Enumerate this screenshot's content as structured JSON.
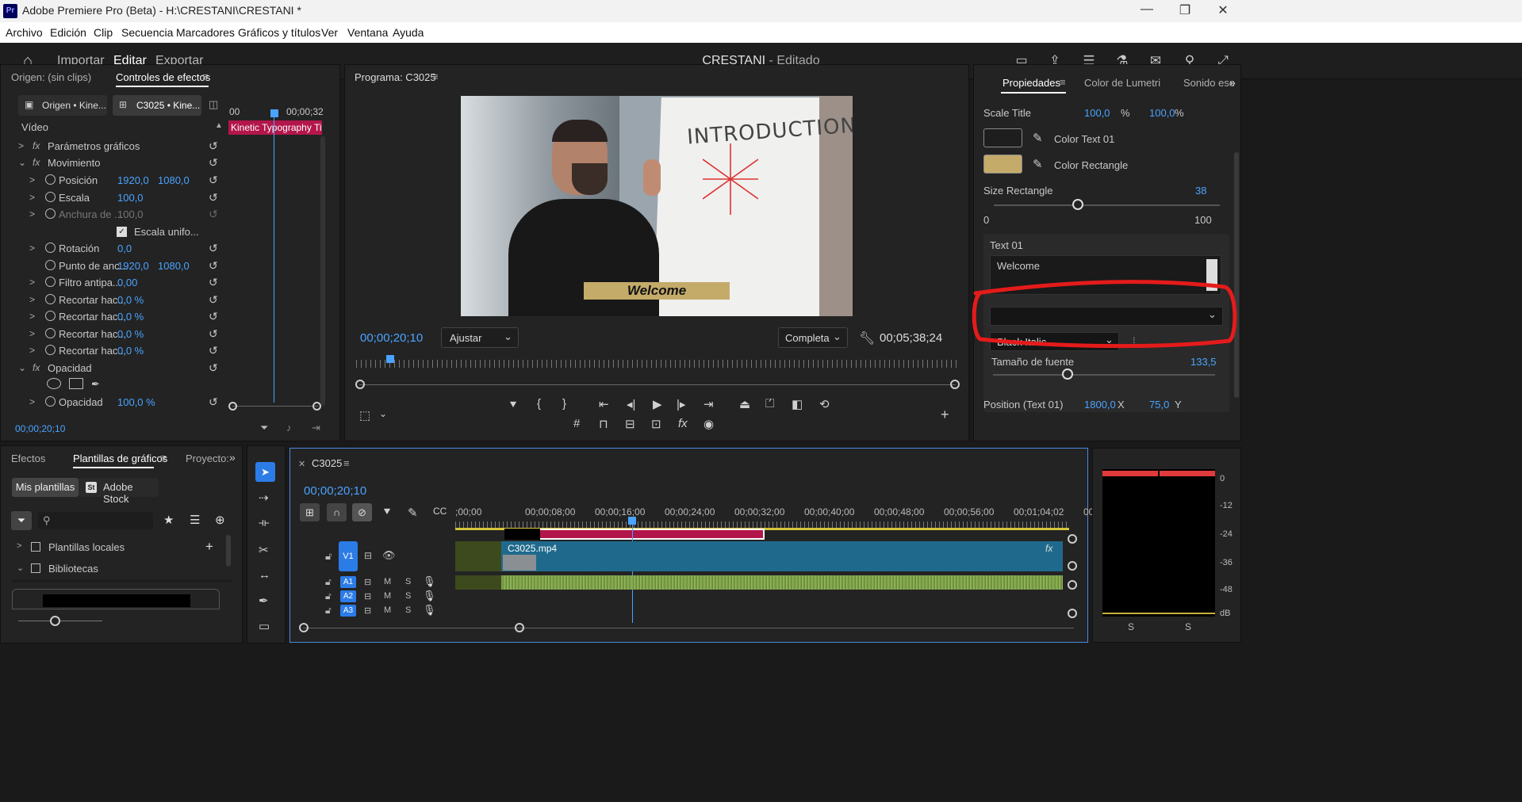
{
  "window": {
    "title": "Adobe Premiere Pro (Beta) - H:\\CRESTANI\\CRESTANI *",
    "app_badge": "Pr",
    "controls": [
      "—",
      "❐",
      "✕"
    ]
  },
  "menu": [
    "Archivo",
    "Edición",
    "Clip",
    "Secuencia",
    "Marcadores",
    "Gráficos y títulos",
    "Ver",
    "Ventana",
    "Ayuda"
  ],
  "header": {
    "nav": [
      "Importar",
      "Editar",
      "Exportar"
    ],
    "project_name": "CRESTANI",
    "project_status": " - Editado"
  },
  "effect_controls": {
    "tabs": [
      "Origen: (sin clips)",
      "Controles de efectos"
    ],
    "source_btn": "Origen • Kine...",
    "seq_btn": "C3025 • Kine...",
    "mini_time_start": "00",
    "mini_time_end": "00;00;32",
    "clip_label": "Kinetic Typography Tit",
    "section": "Vídeo",
    "rows": [
      {
        "label": "Parámetros gráficos",
        "v1": "",
        "v2": ""
      },
      {
        "label": "Movimiento",
        "v1": "",
        "v2": ""
      },
      {
        "label": "Posición",
        "v1": "1920,0",
        "v2": "1080,0"
      },
      {
        "label": "Escala",
        "v1": "100,0",
        "v2": ""
      },
      {
        "label": "Anchura de ...",
        "v1": "100,0",
        "v2": ""
      },
      {
        "label": "Escala unifo...",
        "v1": "",
        "v2": ""
      },
      {
        "label": "Rotación",
        "v1": "0,0",
        "v2": ""
      },
      {
        "label": "Punto de anc...",
        "v1": "1920,0",
        "v2": "1080,0"
      },
      {
        "label": "Filtro antipa...",
        "v1": "0,00",
        "v2": ""
      },
      {
        "label": "Recortar hac...",
        "v1": "0,0 %",
        "v2": ""
      },
      {
        "label": "Recortar hac...",
        "v1": "0,0 %",
        "v2": ""
      },
      {
        "label": "Recortar hac...",
        "v1": "0,0 %",
        "v2": ""
      },
      {
        "label": "Recortar hac...",
        "v1": "0,0 %",
        "v2": ""
      },
      {
        "label": "Opacidad",
        "v1": "",
        "v2": ""
      },
      {
        "label": "",
        "v1": "",
        "v2": ""
      },
      {
        "label": "Opacidad",
        "v1": "100,0 %",
        "v2": ""
      }
    ],
    "timecode": "00;00;20;10"
  },
  "program": {
    "title": "Programa: C3025",
    "timecode": "00;00;20;10",
    "fit": "Ajustar",
    "quality": "Completa",
    "duration": "00;05;38;24",
    "lower_third": "Welcome",
    "board_text": "INTRODUCTION"
  },
  "properties": {
    "tabs": [
      "Propiedades",
      "Color de Lumetri",
      "Sonido ese"
    ],
    "scale_title_label": "Scale Title",
    "scale_x": "100,0",
    "scale_y": "100,0",
    "pct": "%",
    "color_text_label": "Color Text 01",
    "color_rect_label": "Color Rectangle",
    "color_text_hex": "#1e1e1e",
    "color_rect_hex": "#c4ab6a",
    "size_rect_label": "Size Rectangle",
    "size_rect_value": "38",
    "size_min": "0",
    "size_max": "100",
    "text_label": "Text 01",
    "text_value": "Welcome",
    "font_dropdown": "",
    "font_style": "Black Italic",
    "font_size_label": "Tamaño de fuente",
    "font_size_value": "133,5",
    "position_label": "Position (Text 01)",
    "pos_x": "1800,0",
    "pos_x_unit": "X",
    "pos_y": "75,0",
    "pos_y_unit": "Y"
  },
  "graphics": {
    "tabs": [
      "Efectos",
      "Plantillas de gráficos",
      "Proyecto:"
    ],
    "sub_tabs": [
      "Mis plantillas",
      "Adobe Stock"
    ],
    "stock_badge": "St",
    "search_placeholder": "",
    "tree": [
      "Plantillas locales",
      "Bibliotecas"
    ]
  },
  "timeline": {
    "seq_name": "C3025",
    "timecode": "00;00;20;10",
    "ruler": [
      ";00;00",
      "00;00;08;00",
      "00;00;16;00",
      "00;00;24;00",
      "00;00;32;00",
      "00;00;40;00",
      "00;00;48;00",
      "00;00;56;00",
      "00;01;04;02",
      "00"
    ],
    "clip_name": "C3025.mp4",
    "tracks_video": [
      "V1"
    ],
    "tracks_audio": [
      "A1",
      "A2",
      "A3"
    ],
    "track_ms": [
      "M",
      "S"
    ]
  },
  "meter": {
    "scale": [
      "0",
      "-12",
      "-24",
      "-36",
      "-48",
      "dB"
    ],
    "channels": [
      "S",
      "S"
    ]
  },
  "colors": {
    "accent": "#4aa3ff",
    "clip_pink": "#b3164b",
    "clip_teal": "#1f6a8c",
    "audio_green": "#86b04a",
    "annotation_red": "#e51b1b"
  }
}
